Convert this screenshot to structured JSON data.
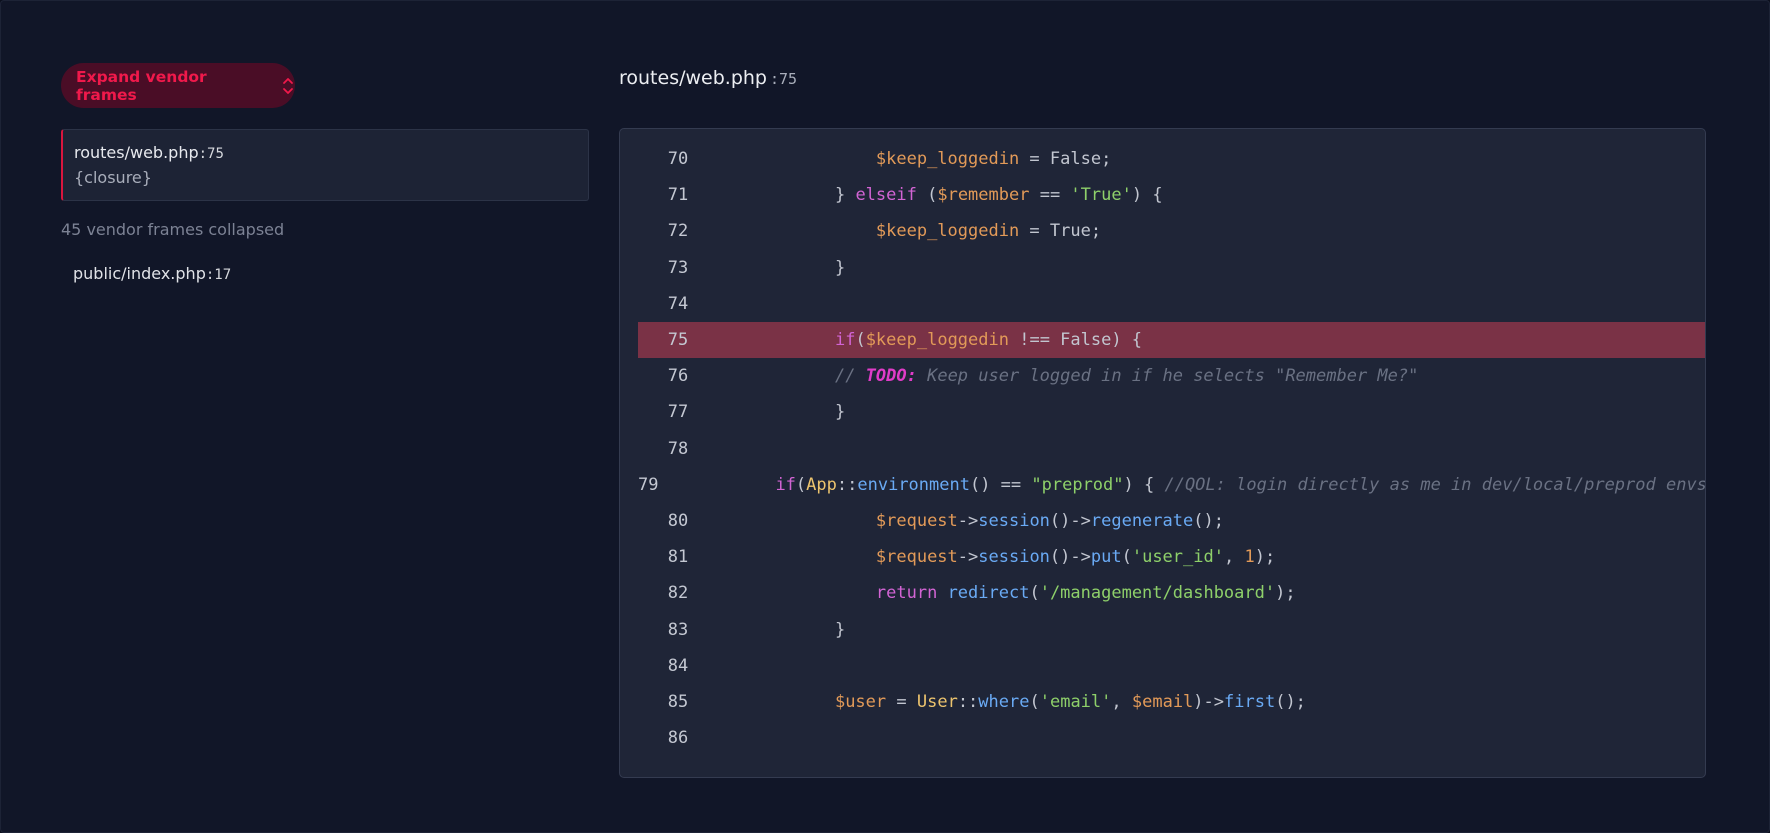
{
  "sidebar": {
    "expand_button_label": "Expand vendor frames",
    "active_frame": {
      "file": "routes/web.php",
      "line": ":75",
      "function": "{closure}"
    },
    "collapsed_note": "45 vendor frames collapsed",
    "other_frames": [
      {
        "file": "public/index.php",
        "line": ":17"
      }
    ]
  },
  "code_view": {
    "file": "routes/web.php",
    "line_suffix": ":75",
    "highlighted_line": 75,
    "lines": [
      {
        "number": "70",
        "indent": 2,
        "tokens": [
          [
            "var",
            "$keep_loggedin"
          ],
          [
            "op",
            " = False;"
          ]
        ]
      },
      {
        "number": "71",
        "indent": 1,
        "tokens": [
          [
            "op",
            "} "
          ],
          [
            "kw",
            "elseif"
          ],
          [
            "op",
            " ("
          ],
          [
            "var",
            "$remember"
          ],
          [
            "op",
            " == "
          ],
          [
            "str",
            "'True'"
          ],
          [
            "op",
            ") {"
          ]
        ]
      },
      {
        "number": "72",
        "indent": 2,
        "tokens": [
          [
            "var",
            "$keep_loggedin"
          ],
          [
            "op",
            " = True;"
          ]
        ]
      },
      {
        "number": "73",
        "indent": 1,
        "tokens": [
          [
            "op",
            "}"
          ]
        ]
      },
      {
        "number": "74",
        "indent": 0,
        "tokens": []
      },
      {
        "number": "75",
        "indent": 1,
        "tokens": [
          [
            "kw",
            "if"
          ],
          [
            "op",
            "("
          ],
          [
            "var",
            "$keep_loggedin"
          ],
          [
            "op",
            " !== False) {"
          ]
        ]
      },
      {
        "number": "76",
        "indent": 1,
        "tokens": [
          [
            "cmt",
            "// "
          ],
          [
            "todo",
            "TODO:"
          ],
          [
            "cmt",
            " Keep user logged in if he selects \"Remember Me?\""
          ]
        ]
      },
      {
        "number": "77",
        "indent": 1,
        "tokens": [
          [
            "op",
            "}"
          ]
        ]
      },
      {
        "number": "78",
        "indent": 0,
        "tokens": []
      },
      {
        "number": "79",
        "indent": 1,
        "tokens": [
          [
            "kw",
            "if"
          ],
          [
            "op",
            "("
          ],
          [
            "cls",
            "App"
          ],
          [
            "op",
            "::"
          ],
          [
            "fn",
            "environment"
          ],
          [
            "op",
            "() == "
          ],
          [
            "str",
            "\"preprod\""
          ],
          [
            "op",
            ") { "
          ],
          [
            "cmt",
            "//QOL: login directly as me in dev/local/preprod envs"
          ]
        ]
      },
      {
        "number": "80",
        "indent": 2,
        "tokens": [
          [
            "var",
            "$request"
          ],
          [
            "op",
            "->"
          ],
          [
            "fn",
            "session"
          ],
          [
            "op",
            "()->"
          ],
          [
            "fn",
            "regenerate"
          ],
          [
            "op",
            "();"
          ]
        ]
      },
      {
        "number": "81",
        "indent": 2,
        "tokens": [
          [
            "var",
            "$request"
          ],
          [
            "op",
            "->"
          ],
          [
            "fn",
            "session"
          ],
          [
            "op",
            "()->"
          ],
          [
            "fn",
            "put"
          ],
          [
            "op",
            "("
          ],
          [
            "str",
            "'user_id'"
          ],
          [
            "op",
            ", "
          ],
          [
            "num",
            "1"
          ],
          [
            "op",
            ");"
          ]
        ]
      },
      {
        "number": "82",
        "indent": 2,
        "tokens": [
          [
            "kw",
            "return"
          ],
          [
            "op",
            " "
          ],
          [
            "fn",
            "redirect"
          ],
          [
            "op",
            "("
          ],
          [
            "str",
            "'/management/dashboard'"
          ],
          [
            "op",
            ");"
          ]
        ]
      },
      {
        "number": "83",
        "indent": 1,
        "tokens": [
          [
            "op",
            "}"
          ]
        ]
      },
      {
        "number": "84",
        "indent": 0,
        "tokens": []
      },
      {
        "number": "85",
        "indent": 1,
        "tokens": [
          [
            "var",
            "$user"
          ],
          [
            "op",
            " = "
          ],
          [
            "cls",
            "User"
          ],
          [
            "op",
            "::"
          ],
          [
            "fn",
            "where"
          ],
          [
            "op",
            "("
          ],
          [
            "str",
            "'email'"
          ],
          [
            "op",
            ", "
          ],
          [
            "var",
            "$email"
          ],
          [
            "op",
            ")->"
          ],
          [
            "fn",
            "first"
          ],
          [
            "op",
            "();"
          ]
        ]
      },
      {
        "number": "86",
        "indent": 0,
        "tokens": []
      }
    ]
  },
  "colors": {
    "accent": "#f0194b",
    "highlight_row": "#7a3246",
    "panel_bg": "#1f2537",
    "page_bg": "#111628"
  }
}
